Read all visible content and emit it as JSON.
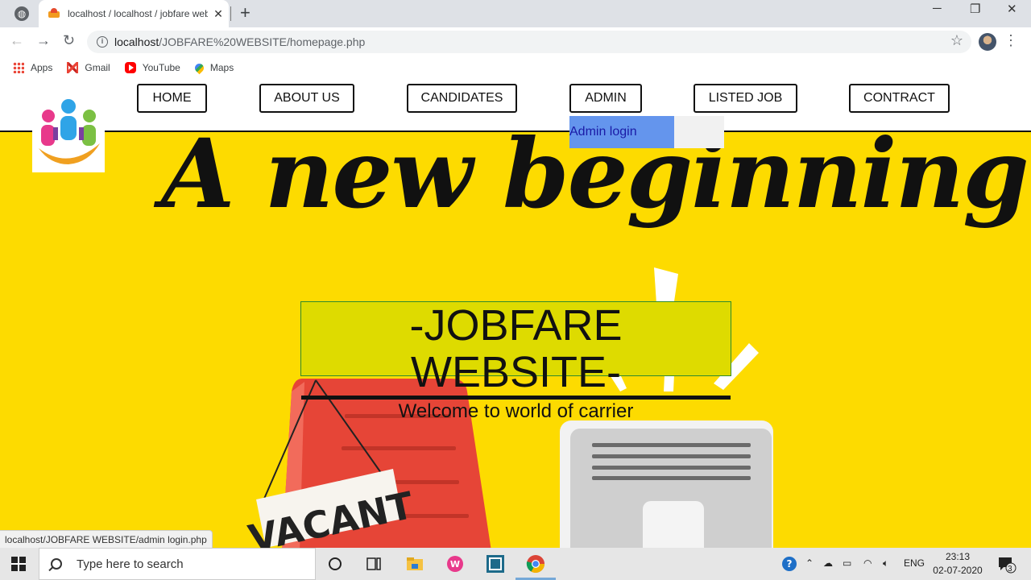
{
  "browser": {
    "tab_title": "localhost / localhost / jobfare web",
    "tab_close": "✕",
    "new_tab": "+",
    "url_host": "localhost",
    "url_path": "/JOBFARE%20WEBSITE/homepage.php",
    "status_url": "localhost/JOBFARE WEBSITE/admin login.php",
    "bookmarks": [
      "Apps",
      "Gmail",
      "YouTube",
      "Maps"
    ]
  },
  "nav": {
    "home": "HOME",
    "about": "ABOUT US",
    "candidates": "CANDIDATES",
    "admin": "ADMIN",
    "listed_job": "LISTED JOB",
    "contract": "CONTRACT",
    "dropdown_item": "Admin login"
  },
  "hero": {
    "headline": "A new beginning...",
    "site_title": "-JOBFARE WEBSITE-",
    "tagline": "Welcome to world of carrier",
    "vacant_sign": "VACANT",
    "bg_color": "#fddb00"
  },
  "taskbar": {
    "search_placeholder": "Type here to search",
    "language": "ENG",
    "time": "23:13",
    "date": "02-07-2020",
    "notif_count": "3"
  }
}
